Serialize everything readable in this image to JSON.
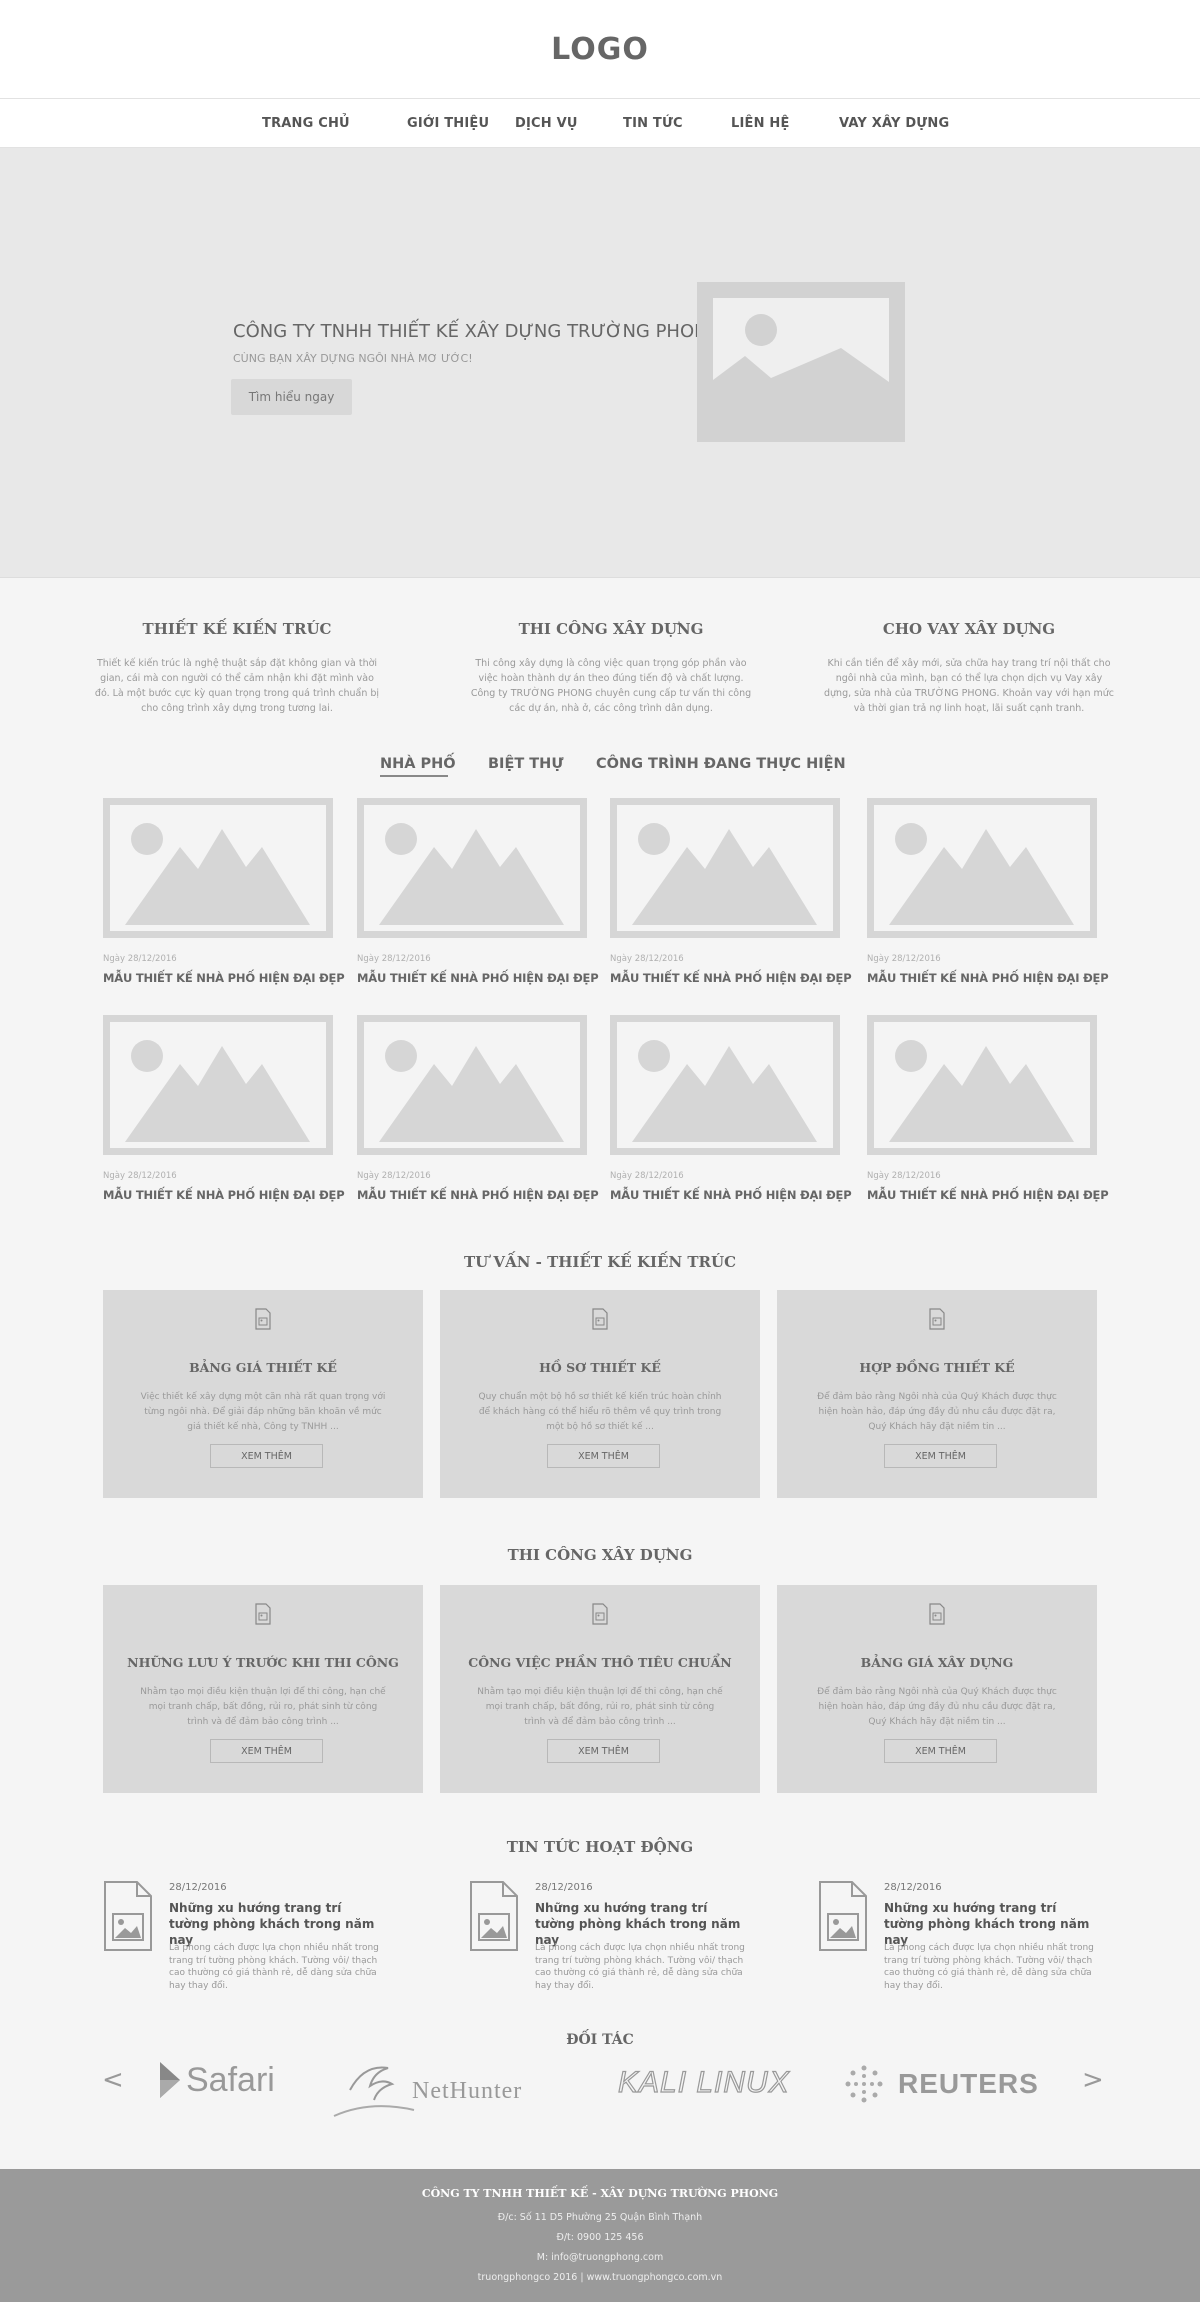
{
  "header": {
    "logo": "LOGO"
  },
  "nav": {
    "items": [
      {
        "label": "TRANG CHỦ"
      },
      {
        "label": "GIỚI THIỆU"
      },
      {
        "label": "DỊCH VỤ"
      },
      {
        "label": "TIN TỨC"
      },
      {
        "label": "LIÊN HỆ"
      },
      {
        "label": "VAY XÂY DỰNG"
      }
    ]
  },
  "hero": {
    "title": "CÔNG TY TNHH THIẾT KẾ XÂY DỰNG TRƯỜNG PHONG",
    "subtitle": "CÙNG BẠN XÂY DỰNG NGÔI NHÀ MƠ ƯỚC!",
    "button": "Tìm hiểu ngay"
  },
  "services": [
    {
      "title": "THIẾT KẾ KIẾN TRÚC",
      "text": "Thiết kế kiến trúc là nghệ thuật sắp đặt không gian và thời gian, cái mà con người có thể cảm nhận khi đặt mình vào đó. Là một bước cực kỳ quan trọng trong quá trình chuẩn bị cho công trình xây dựng trong tương lai."
    },
    {
      "title": "THI CÔNG XÂY DỰNG",
      "text": "Thi công xây dựng là công việc quan trọng góp phần vào việc hoàn thành dự án theo đúng tiến độ và chất lượng. Công ty TRƯỜNG PHONG chuyên cung cấp tư vấn thi công các dự án, nhà ở, các công trình dân dụng."
    },
    {
      "title": "CHO VAY XÂY DỰNG",
      "text": "Khi cần tiền để xây mới, sửa chữa hay trang trí nội thất cho ngôi nhà của mình, bạn có thể lựa chọn dịch vụ Vay xây dựng, sửa nhà của TRƯỜNG PHONG. Khoản vay với hạn mức và thời gian trả nợ linh hoạt, lãi suất cạnh tranh."
    }
  ],
  "tabs": [
    {
      "label": "NHÀ PHỐ",
      "active": true
    },
    {
      "label": "BIỆT THỰ"
    },
    {
      "label": "CÔNG TRÌNH ĐANG THỰC HIỆN"
    }
  ],
  "products": [
    {
      "date": "Ngày 28/12/2016",
      "name": "MẪU THIẾT KẾ NHÀ PHỐ HIỆN ĐẠI ĐẸP"
    },
    {
      "date": "Ngày 28/12/2016",
      "name": "MẪU THIẾT KẾ NHÀ PHỐ HIỆN ĐẠI ĐẸP"
    },
    {
      "date": "Ngày 28/12/2016",
      "name": "MẪU THIẾT KẾ NHÀ PHỐ HIỆN ĐẠI ĐẸP"
    },
    {
      "date": "Ngày 28/12/2016",
      "name": "MẪU THIẾT KẾ NHÀ PHỐ HIỆN ĐẠI ĐẸP"
    },
    {
      "date": "Ngày 28/12/2016",
      "name": "MẪU THIẾT KẾ NHÀ PHỐ HIỆN ĐẠI ĐẸP"
    },
    {
      "date": "Ngày 28/12/2016",
      "name": "MẪU THIẾT KẾ NHÀ PHỐ HIỆN ĐẠI ĐẸP"
    },
    {
      "date": "Ngày 28/12/2016",
      "name": "MẪU THIẾT KẾ NHÀ PHỐ HIỆN ĐẠI ĐẸP"
    },
    {
      "date": "Ngày 28/12/2016",
      "name": "MẪU THIẾT KẾ NHÀ PHỐ HIỆN ĐẠI ĐẸP"
    }
  ],
  "consult": {
    "title": "TƯ VẤN - THIẾT KẾ KIẾN TRÚC",
    "cards": [
      {
        "title": "BẢNG GIÁ THIẾT KẾ",
        "text": "Việc thiết kế xây dựng một căn nhà rất quan trọng với từng ngôi nhà. Để giải đáp những băn khoăn về mức giá thiết kế nhà, Công ty TNHH ...",
        "button": "XEM THÊM"
      },
      {
        "title": "HỒ SƠ THIẾT KẾ",
        "text": "Quy chuẩn một bộ hồ sơ thiết kế kiến trúc hoàn chỉnh để khách hàng có thể hiểu rõ thêm về quy trình trong một bộ hồ sơ thiết kế ...",
        "button": "XEM THÊM"
      },
      {
        "title": "HỢP ĐỒNG THIẾT KẾ",
        "text": "Để đảm bảo rằng Ngôi nhà của Quý Khách được thực hiện hoàn hảo, đáp ứng đầy đủ nhu cầu được đặt ra, Quý Khách hãy đặt niềm tin ...",
        "button": "XEM THÊM"
      }
    ]
  },
  "construction": {
    "title": "THI CÔNG XÂY DỰNG",
    "cards": [
      {
        "title": "NHỮNG LƯU Ý TRƯỚC KHI THI CÔNG",
        "text": "Nhằm tạo mọi điều kiện thuận lợi để thi công, hạn chế mọi tranh chấp, bất đồng, rủi ro, phát sinh từ công trình và để đảm bảo công trình ...",
        "button": "XEM THÊM"
      },
      {
        "title": "CÔNG VIỆC PHẦN THÔ TIÊU CHUẨN",
        "text": "Nhằm tạo mọi điều kiện thuận lợi để thi công, hạn chế mọi tranh chấp, bất đồng, rủi ro, phát sinh từ công trình và để đảm bảo công trình ...",
        "button": "XEM THÊM"
      },
      {
        "title": "BẢNG GIÁ XÂY DỰNG",
        "text": "Để đảm bảo rằng Ngôi nhà của Quý Khách được thực hiện hoàn hảo, đáp ứng đầy đủ nhu cầu được đặt ra, Quý Khách hãy đặt niềm tin ...",
        "button": "XEM THÊM"
      }
    ]
  },
  "news": {
    "title": "TIN TỨC HOẠT ĐỘNG",
    "items": [
      {
        "date": "28/12/2016",
        "title": "Những xu hướng trang trí tường phòng khách trong năm nay",
        "text": "Lá phong cách được lựa chọn nhiều nhất trong trang trí tường phòng khách. Tường vôi/ thạch cao thường có giá thành rẻ, dễ dàng sửa chữa hay thay đổi."
      },
      {
        "date": "28/12/2016",
        "title": "Những xu hướng trang trí tường phòng khách trong năm nay",
        "text": "Lá phong cách được lựa chọn nhiều nhất trong trang trí tường phòng khách. Tường vôi/ thạch cao thường có giá thành rẻ, dễ dàng sửa chữa hay thay đổi."
      },
      {
        "date": "28/12/2016",
        "title": "Những xu hướng trang trí tường phòng khách trong năm nay",
        "text": "Lá phong cách được lựa chọn nhiều nhất trong trang trí tường phòng khách. Tường vôi/ thạch cao thường có giá thành rẻ, dễ dàng sửa chữa hay thay đổi."
      }
    ]
  },
  "partners": {
    "title": "ĐỐI TÁC",
    "prev": "<",
    "next": ">",
    "logos": [
      {
        "name": "Safari"
      },
      {
        "name": "NetHunter"
      },
      {
        "name": "KALI LINUX"
      },
      {
        "name": "REUTERS"
      }
    ]
  },
  "footer": {
    "company": "CÔNG TY TNHH THIẾT KẾ - XÂY DỰNG TRƯỜNG PHONG",
    "address": "Đ/c: Số 11 D5 Phường 25 Quận Bình Thạnh",
    "phone": "Đ/t: 0900 125 456",
    "email": "M: info@truongphong.com",
    "web": "truongphongco 2016 | www.truongphongco.com.vn"
  }
}
